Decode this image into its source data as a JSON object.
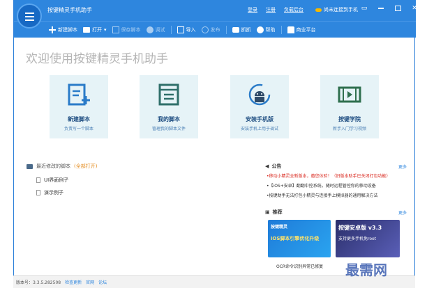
{
  "titlebar": {
    "app_title": "按键精灵手机助手",
    "links": [
      "登录",
      "注册",
      "负载后台"
    ],
    "phone_status": "尚未连接到手机"
  },
  "toolbar": {
    "new": "新建脚本",
    "open": "打开",
    "save": "保存脚本",
    "debug": "调试",
    "import": "导入",
    "publish": "发布",
    "capture": "抓抓",
    "help": "帮助",
    "store": "商业平台"
  },
  "welcome": "欢迎使用按键精灵手机助手",
  "tiles": [
    {
      "name": "新建脚本",
      "desc": "负责写一个脚本"
    },
    {
      "name": "我的脚本",
      "desc": "管理我的脚本文件"
    },
    {
      "name": "安装手机版",
      "desc": "安装手机上用于调试"
    },
    {
      "name": "按键学院",
      "desc": "新手入门学习视频"
    }
  ],
  "recent": {
    "title": "最近修改的脚本",
    "open_all": "(全部打开)",
    "items": [
      "UI界面例子",
      "演示例子"
    ]
  },
  "notice": {
    "title": "公告",
    "more": "更多",
    "items": [
      "•移动小精灵全新版本，邀您体验！（旧版本助手已关闭打包功能）",
      "•【iOS+安卓】翻翻中控系统，随时远程管控你的移动设备",
      "•按键助手无法打包小精灵与连接手上模拟器的通用解决方法"
    ]
  },
  "recommend": {
    "title": "推荐",
    "more": "更多",
    "promo1_title": "按键精灵",
    "promo1_body": "iOS脚本引擎优化升级",
    "promo2_title": "按键安卓版 v3.3",
    "promo2_body": "支持更多手机免root",
    "caption": "OCR命令识别异常已修复"
  },
  "status": {
    "version": "版本号：3.3.5.282508",
    "links": [
      "检查更新",
      "官网",
      "论坛"
    ]
  },
  "watermark": "最需网",
  "colors": {
    "accent": "#2e86de",
    "tile_bg": "#e6f3f7",
    "highlight": "#d9261c"
  }
}
